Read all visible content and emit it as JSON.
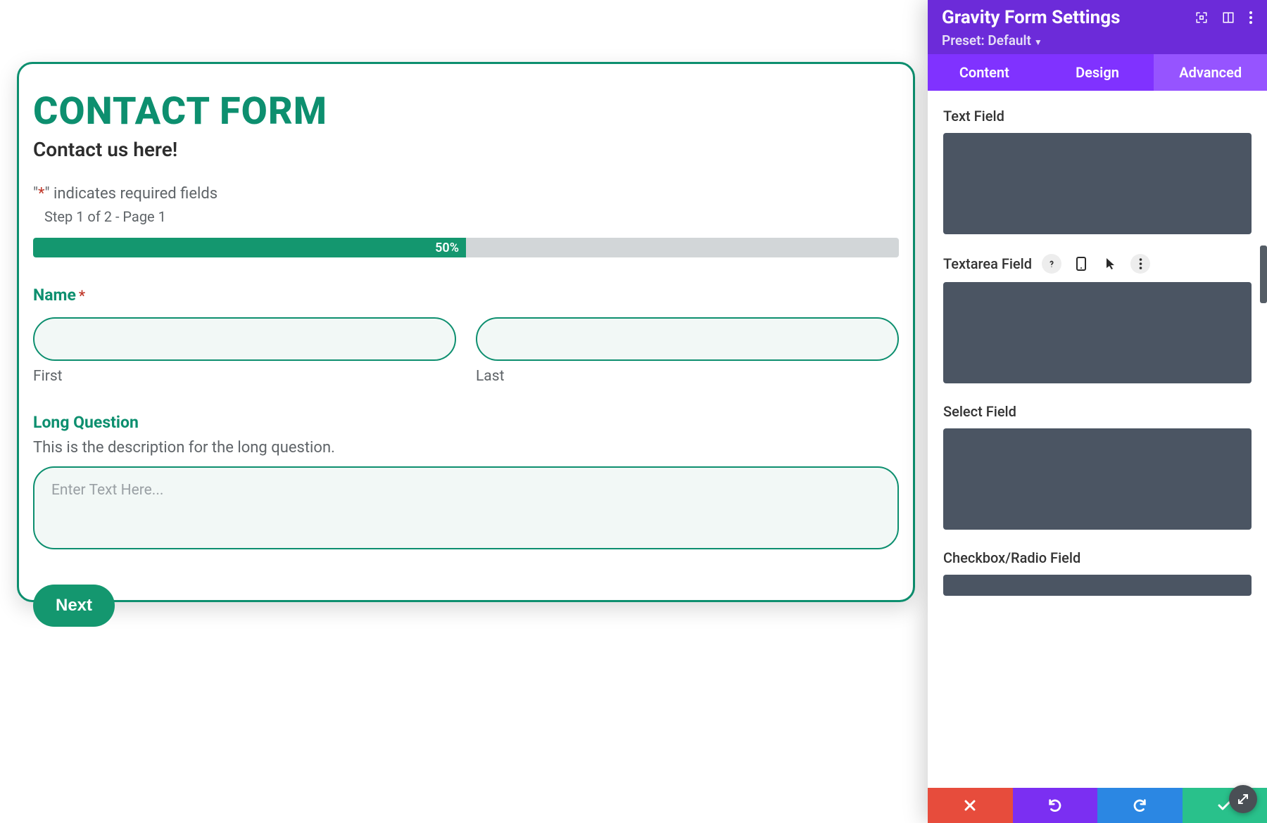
{
  "form": {
    "title": "CONTACT FORM",
    "subtitle": "Contact us here!",
    "required_note_prefix": "\"",
    "required_note_ast": "*",
    "required_note_suffix": "\" indicates required fields",
    "step_note": "Step 1 of 2 - Page 1",
    "progress": {
      "percent": 50,
      "label": "50%"
    },
    "fields": {
      "name": {
        "label": "Name",
        "required_marker": "*",
        "first_sub": "First",
        "last_sub": "Last",
        "first_value": "",
        "last_value": ""
      },
      "long_question": {
        "label": "Long Question",
        "description": "This is the description for the long question.",
        "placeholder": "Enter Text Here...",
        "value": ""
      }
    },
    "next_label": "Next"
  },
  "panel": {
    "title": "Gravity Form Settings",
    "preset_label": "Preset: Default",
    "tabs": [
      {
        "id": "content",
        "label": "Content",
        "active": false
      },
      {
        "id": "design",
        "label": "Design",
        "active": false
      },
      {
        "id": "advanced",
        "label": "Advanced",
        "active": true
      }
    ],
    "groups": {
      "text": {
        "label": "Text Field"
      },
      "textarea": {
        "label": "Textarea Field",
        "show_tools": true
      },
      "select": {
        "label": "Select Field"
      },
      "checkbox": {
        "label": "Checkbox/Radio Field"
      }
    },
    "icons": {
      "help": "help-icon",
      "mobile": "mobile-icon",
      "hover": "cursor-icon",
      "more": "more-vert-icon"
    }
  },
  "colors": {
    "accent": "#0d8f6f",
    "panel_header": "#6c2bd9",
    "panel_tabs": "#8032ff",
    "panel_tab_active": "#9654ff",
    "code_block": "#4b5563",
    "cancel": "#e74c3c",
    "undo": "#7b2ff2",
    "redo": "#2b87e3",
    "save": "#29c18b"
  }
}
